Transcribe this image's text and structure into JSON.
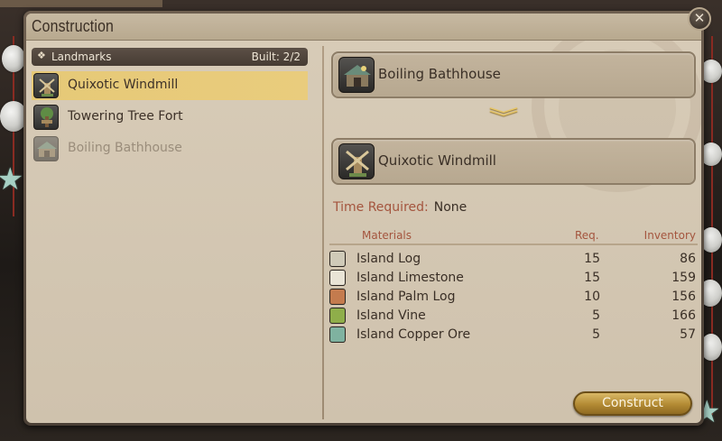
{
  "window": {
    "title": "Construction",
    "close_glyph": "✕"
  },
  "landmarks": {
    "category_icon": "diamond-bullet-icon",
    "category_glyph": "❖",
    "category_label": "Landmarks",
    "built_label": "Built: 2/2",
    "items": [
      {
        "label": "Quixotic Windmill",
        "icon": "windmill-icon",
        "state": "selected"
      },
      {
        "label": "Towering Tree Fort",
        "icon": "tree-fort-icon",
        "state": "built"
      },
      {
        "label": "Boiling Bathhouse",
        "icon": "bathhouse-icon",
        "state": "unavailable"
      }
    ]
  },
  "conversion": {
    "from_label": "Boiling Bathhouse",
    "from_icon": "bathhouse-icon",
    "arrow_glyph": "︾",
    "to_label": "Quixotic Windmill",
    "to_icon": "windmill-icon"
  },
  "time": {
    "label": "Time Required:",
    "value": "None"
  },
  "materials": {
    "headers": {
      "name": "Materials",
      "req": "Req.",
      "inventory": "Inventory"
    },
    "rows": [
      {
        "icon": "island-log-icon",
        "color": "#cfcab8",
        "name": "Island Log",
        "req": "15",
        "inventory": "86"
      },
      {
        "icon": "island-limestone-icon",
        "color": "#e9e4d6",
        "name": "Island Limestone",
        "req": "15",
        "inventory": "159"
      },
      {
        "icon": "island-palm-log-icon",
        "color": "#c47b4e",
        "name": "Island Palm Log",
        "req": "10",
        "inventory": "156"
      },
      {
        "icon": "island-vine-icon",
        "color": "#8fae4a",
        "name": "Island Vine",
        "req": "5",
        "inventory": "166"
      },
      {
        "icon": "island-copper-ore-icon",
        "color": "#7fb2a0",
        "name": "Island Copper Ore",
        "req": "5",
        "inventory": "57"
      }
    ]
  },
  "actions": {
    "construct_label": "Construct"
  },
  "colors": {
    "accent_gold": "#e6c977",
    "label_rust": "#a4553e",
    "panel_bg": "#d8ccb8"
  }
}
